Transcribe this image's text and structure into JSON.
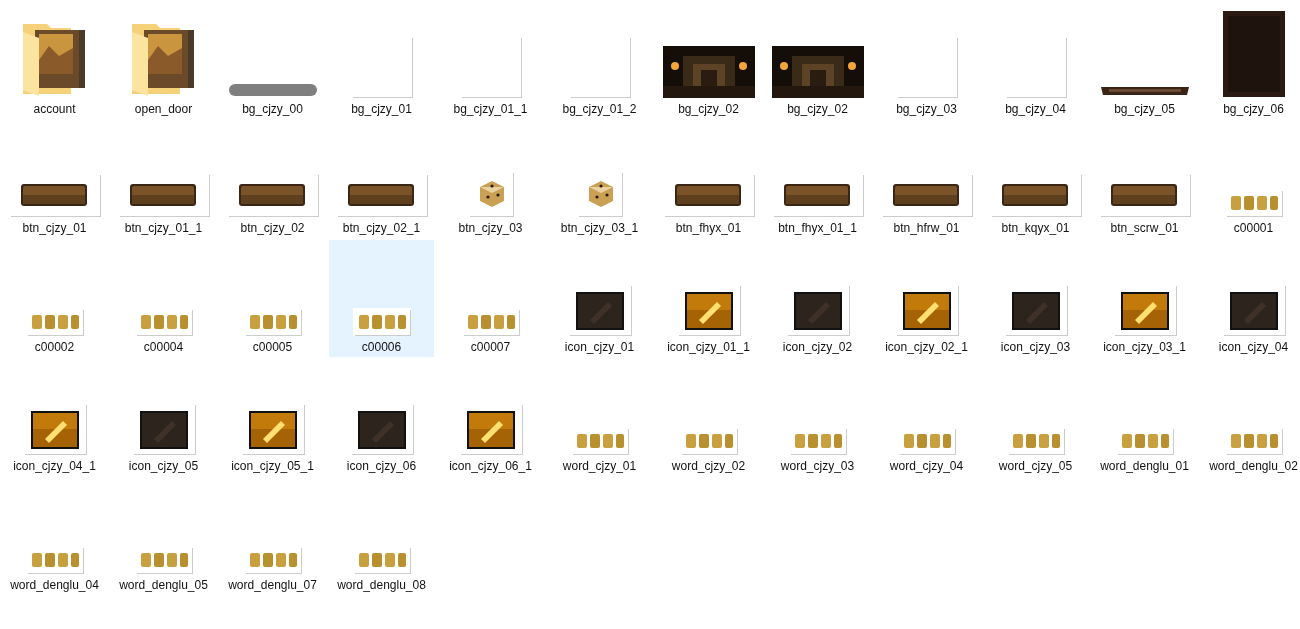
{
  "files": [
    {
      "name": "account",
      "kind": "folder",
      "selected": false
    },
    {
      "name": "open_door",
      "kind": "folder",
      "selected": false
    },
    {
      "name": "bg_cjzy_00",
      "kind": "bar",
      "selected": false
    },
    {
      "name": "bg_cjzy_01",
      "kind": "blank",
      "selected": false
    },
    {
      "name": "bg_cjzy_01_1",
      "kind": "blank",
      "selected": false
    },
    {
      "name": "bg_cjzy_01_2",
      "kind": "blank",
      "selected": false
    },
    {
      "name": "bg_cjzy_02",
      "kind": "scene",
      "selected": false
    },
    {
      "name": "bg_cjzy_02",
      "kind": "scene",
      "selected": false
    },
    {
      "name": "bg_cjzy_03",
      "kind": "blank",
      "selected": false
    },
    {
      "name": "bg_cjzy_04",
      "kind": "blank",
      "selected": false
    },
    {
      "name": "bg_cjzy_05",
      "kind": "strip",
      "selected": false
    },
    {
      "name": "bg_cjzy_06",
      "kind": "panel",
      "selected": false
    },
    {
      "name": "btn_cjzy_01",
      "kind": "button",
      "selected": false
    },
    {
      "name": "btn_cjzy_01_1",
      "kind": "button",
      "selected": false
    },
    {
      "name": "btn_cjzy_02",
      "kind": "button",
      "selected": false
    },
    {
      "name": "btn_cjzy_02_1",
      "kind": "button",
      "selected": false
    },
    {
      "name": "btn_cjzy_03",
      "kind": "dice",
      "selected": false
    },
    {
      "name": "btn_cjzy_03_1",
      "kind": "dice",
      "selected": false
    },
    {
      "name": "btn_fhyx_01",
      "kind": "button",
      "selected": false
    },
    {
      "name": "btn_fhyx_01_1",
      "kind": "button",
      "selected": false
    },
    {
      "name": "btn_hfrw_01",
      "kind": "button",
      "selected": false
    },
    {
      "name": "btn_kqyx_01",
      "kind": "button",
      "selected": false
    },
    {
      "name": "btn_scrw_01",
      "kind": "button",
      "selected": false
    },
    {
      "name": "c00001",
      "kind": "word",
      "selected": false
    },
    {
      "name": "c00002",
      "kind": "word",
      "selected": false
    },
    {
      "name": "c00004",
      "kind": "word",
      "selected": false
    },
    {
      "name": "c00005",
      "kind": "word",
      "selected": false
    },
    {
      "name": "c00006",
      "kind": "word",
      "selected": true
    },
    {
      "name": "c00007",
      "kind": "word",
      "selected": false
    },
    {
      "name": "icon_cjzy_01",
      "kind": "icon_dark",
      "selected": false
    },
    {
      "name": "icon_cjzy_01_1",
      "kind": "icon_gold",
      "selected": false
    },
    {
      "name": "icon_cjzy_02",
      "kind": "icon_dark",
      "selected": false
    },
    {
      "name": "icon_cjzy_02_1",
      "kind": "icon_gold",
      "selected": false
    },
    {
      "name": "icon_cjzy_03",
      "kind": "icon_dark",
      "selected": false
    },
    {
      "name": "icon_cjzy_03_1",
      "kind": "icon_gold",
      "selected": false
    },
    {
      "name": "icon_cjzy_04",
      "kind": "icon_dark",
      "selected": false
    },
    {
      "name": "icon_cjzy_04_1",
      "kind": "icon_gold",
      "selected": false
    },
    {
      "name": "icon_cjzy_05",
      "kind": "icon_dark",
      "selected": false
    },
    {
      "name": "icon_cjzy_05_1",
      "kind": "icon_gold",
      "selected": false
    },
    {
      "name": "icon_cjzy_06",
      "kind": "icon_dark",
      "selected": false
    },
    {
      "name": "icon_cjzy_06_1",
      "kind": "icon_gold",
      "selected": false
    },
    {
      "name": "word_cjzy_01",
      "kind": "word",
      "selected": false
    },
    {
      "name": "word_cjzy_02",
      "kind": "word",
      "selected": false
    },
    {
      "name": "word_cjzy_03",
      "kind": "word",
      "selected": false
    },
    {
      "name": "word_cjzy_04",
      "kind": "word",
      "selected": false
    },
    {
      "name": "word_cjzy_05",
      "kind": "word",
      "selected": false
    },
    {
      "name": "word_denglu_01",
      "kind": "word",
      "selected": false
    },
    {
      "name": "word_denglu_02",
      "kind": "word",
      "selected": false
    },
    {
      "name": "word_denglu_04",
      "kind": "word",
      "selected": false
    },
    {
      "name": "word_denglu_05",
      "kind": "word",
      "selected": false
    },
    {
      "name": "word_denglu_07",
      "kind": "word",
      "selected": false
    },
    {
      "name": "word_denglu_08",
      "kind": "word",
      "selected": false
    }
  ]
}
